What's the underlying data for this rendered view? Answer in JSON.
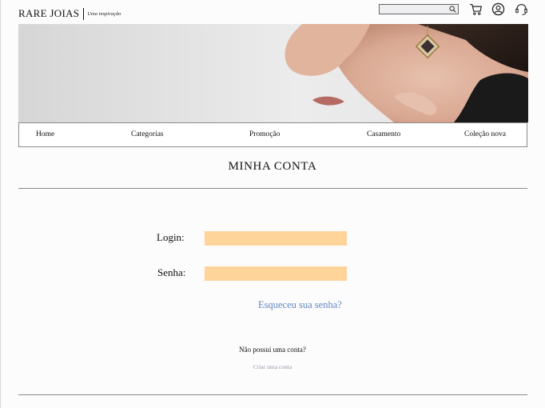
{
  "brand": {
    "name": "RARE JOIAS",
    "tagline": "Uma inspiração"
  },
  "header": {
    "search": {
      "value": "",
      "placeholder": ""
    },
    "icons": [
      "search-icon",
      "cart-icon",
      "user-account-icon",
      "headset-support-icon"
    ]
  },
  "nav": {
    "items": [
      {
        "label": "Home"
      },
      {
        "label": "Categorias"
      },
      {
        "label": "Promoção"
      },
      {
        "label": "Casamento"
      },
      {
        "label": "Coleção nova"
      }
    ]
  },
  "page": {
    "title": "MINHA CONTA"
  },
  "login_form": {
    "login_label": "Login:",
    "password_label": "Senha:",
    "login_value": "",
    "password_value": "",
    "forgot_password": "Esqueceu sua senha?",
    "no_account": "Não possui uma conta?",
    "create_account": "Criar uma conta"
  },
  "colors": {
    "input_fill": "#ffd49b",
    "link": "#5e86c3",
    "muted_link": "#8f9aa8",
    "rule": "#8a8a8a"
  }
}
